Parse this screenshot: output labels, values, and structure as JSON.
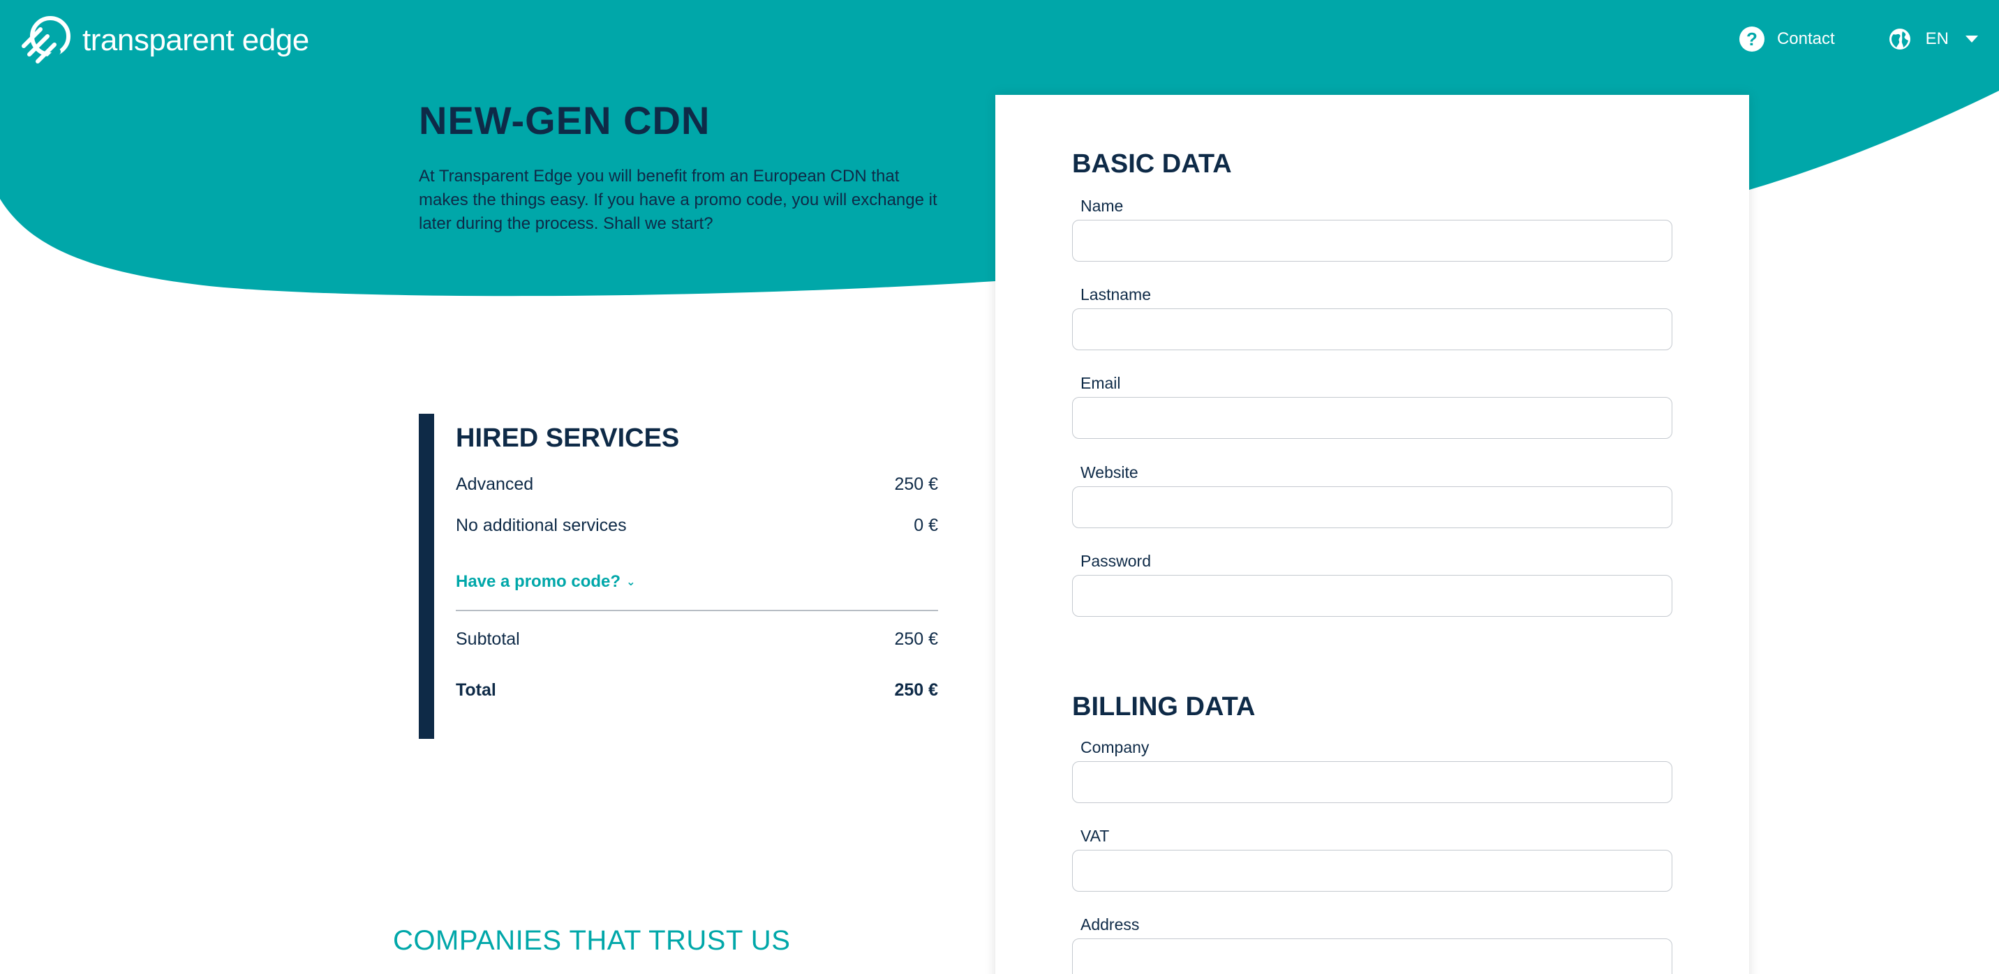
{
  "brand": {
    "name": "transparent edge",
    "color_primary": "#00a7a9",
    "color_dark": "#0e2a47"
  },
  "header": {
    "contact_label": "Contact",
    "contact_icon": "help-circle-icon",
    "language_label": "EN",
    "language_icon": "globe-icon"
  },
  "hero": {
    "title": "NEW-GEN CDN",
    "description": "At Transparent Edge you will benefit from an European CDN that makes the things easy. If you have a promo code, you will exchange it later during the process. Shall we start?"
  },
  "services": {
    "title": "HIRED SERVICES",
    "items": [
      {
        "name": "Advanced",
        "price": "250 €"
      },
      {
        "name": "No additional services",
        "price": "0 €"
      }
    ],
    "promo_label": "Have a promo code?",
    "subtotal_label": "Subtotal",
    "subtotal_value": "250 €",
    "total_label": "Total",
    "total_value": "250 €"
  },
  "companies": {
    "title": "COMPANIES THAT TRUST US"
  },
  "form": {
    "basic_title": "BASIC DATA",
    "basic_fields": [
      {
        "label": "Name",
        "value": ""
      },
      {
        "label": "Lastname",
        "value": ""
      },
      {
        "label": "Email",
        "value": ""
      },
      {
        "label": "Website",
        "value": ""
      },
      {
        "label": "Password",
        "value": ""
      }
    ],
    "billing_title": "BILLING DATA",
    "billing_fields": [
      {
        "label": "Company",
        "value": ""
      },
      {
        "label": "VAT",
        "value": ""
      },
      {
        "label": "Address",
        "value": ""
      }
    ]
  }
}
